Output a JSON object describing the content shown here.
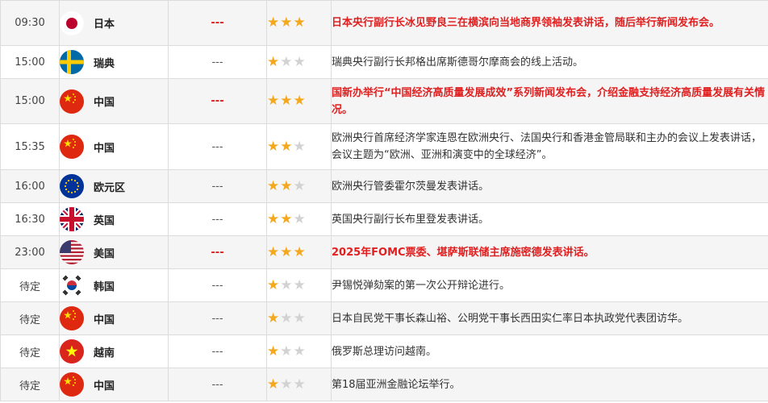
{
  "colors": {
    "important": "#e02020",
    "star_on": "#f4a81e",
    "star_off": "#d2d2d2",
    "row_alt": "#f5f5f5"
  },
  "rows": [
    {
      "time": "09:30",
      "flag": "japan-flag-icon",
      "country": "日本",
      "value": "---",
      "stars": 3,
      "important": true,
      "desc": "日本央行副行长冰见野良三在横滨向当地商界领袖发表讲话，随后举行新闻发布会。"
    },
    {
      "time": "15:00",
      "flag": "sweden-flag-icon",
      "country": "瑞典",
      "value": "---",
      "stars": 1,
      "important": false,
      "desc": "瑞典央行副行长邦格出席斯德哥尔摩商会的线上活动。"
    },
    {
      "time": "15:00",
      "flag": "china-flag-icon",
      "country": "中国",
      "value": "---",
      "stars": 3,
      "important": true,
      "desc": "国新办举行“中国经济高质量发展成效”系列新闻发布会，介绍金融支持经济高质量发展有关情况。"
    },
    {
      "time": "15:35",
      "flag": "china-flag-icon",
      "country": "中国",
      "value": "---",
      "stars": 2,
      "important": false,
      "desc": "欧洲央行首席经济学家连恩在欧洲央行、法国央行和香港金管局联和主办的会议上发表讲话，会议主题为“欧洲、亚洲和演变中的全球经济”。"
    },
    {
      "time": "16:00",
      "flag": "eu-flag-icon",
      "country": "欧元区",
      "value": "---",
      "stars": 2,
      "important": false,
      "desc": "欧洲央行管委霍尔茨曼发表讲话。"
    },
    {
      "time": "16:30",
      "flag": "uk-flag-icon",
      "country": "英国",
      "value": "---",
      "stars": 2,
      "important": false,
      "desc": "英国央行副行长布里登发表讲话。"
    },
    {
      "time": "23:00",
      "flag": "usa-flag-icon",
      "country": "美国",
      "value": "---",
      "stars": 3,
      "important": true,
      "desc": "2025年FOMC票委、堪萨斯联储主席施密德发表讲话。"
    },
    {
      "time": "待定",
      "flag": "korea-flag-icon",
      "country": "韩国",
      "value": "---",
      "stars": 1,
      "important": false,
      "desc": "尹锡悦弹劾案的第一次公开辩论进行。"
    },
    {
      "time": "待定",
      "flag": "china-flag-icon",
      "country": "中国",
      "value": "---",
      "stars": 1,
      "important": false,
      "desc": "日本自民党干事长森山裕、公明党干事长西田实仁率日本执政党代表团访华。"
    },
    {
      "time": "待定",
      "flag": "vietnam-flag-icon",
      "country": "越南",
      "value": "---",
      "stars": 1,
      "important": false,
      "desc": "俄罗斯总理访问越南。"
    },
    {
      "time": "待定",
      "flag": "china-flag-icon",
      "country": "中国",
      "value": "---",
      "stars": 1,
      "important": false,
      "desc": "第18届亚洲金融论坛举行。"
    }
  ]
}
